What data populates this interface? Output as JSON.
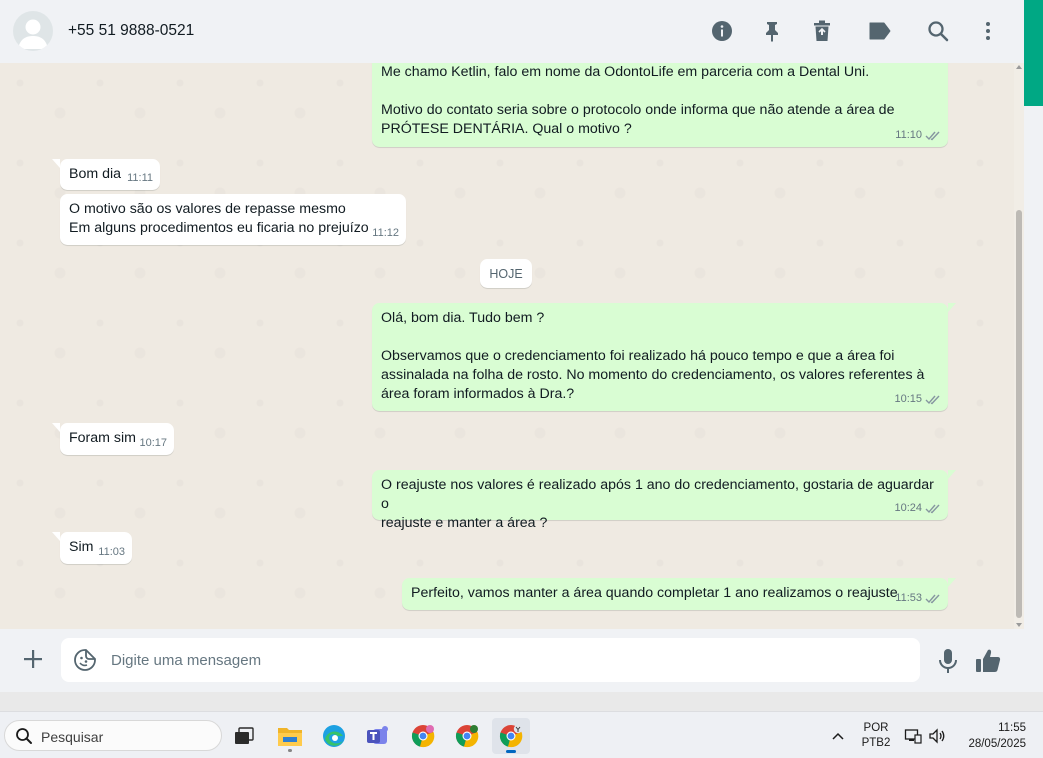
{
  "header": {
    "contact": "+55 51 9888-0521",
    "icons": [
      "info-icon",
      "pin-icon",
      "delete-icon",
      "label-icon",
      "search-icon",
      "menu-icon"
    ]
  },
  "messages": [
    {
      "dir": "out",
      "text": "Me chamo Ketlin, falo em nome da OdontoLife em parceria com a Dental Uni.\n\nMotivo do contato seria sobre o protocolo onde informa que não atende a área de\nPRÓTESE DENTÁRIA. Qual o motivo ?",
      "time": "11:10"
    },
    {
      "dir": "in",
      "text": "Bom dia",
      "time": "11:11"
    },
    {
      "dir": "in",
      "text": "O motivo são os valores de repasse mesmo\nEm alguns procedimentos eu ficaria no prejuízo",
      "time": "11:12"
    },
    {
      "dir": "out",
      "text": "Olá, bom dia. Tudo bem ?\n\nObservamos que o credenciamento foi realizado há pouco tempo e que a área foi\nassinalada na folha de rosto. No momento do credenciamento, os valores referentes à\nárea foram informados à Dra.?",
      "time": "10:15"
    },
    {
      "dir": "in",
      "text": "Foram sim",
      "time": "10:17"
    },
    {
      "dir": "out",
      "text": "O reajuste nos valores é realizado após 1 ano do credenciamento, gostaria de aguardar o\nreajuste e manter a área ?",
      "time": "10:24"
    },
    {
      "dir": "in",
      "text": "Sim",
      "time": "11:03"
    },
    {
      "dir": "out",
      "text": "Perfeito, vamos manter a área quando completar 1 ano realizamos o reajuste",
      "time": "11:53"
    }
  ],
  "date_chip": "HOJE",
  "composer": {
    "placeholder": "Digite uma mensagem"
  },
  "taskbar": {
    "search_label": "Pesquisar",
    "lang_line1": "POR",
    "lang_line2": "PTB2",
    "time": "11:55",
    "date": "28/05/2025"
  },
  "colors": {
    "outgoing_bubble": "#d9fdd3",
    "incoming_bubble": "#ffffff",
    "chat_background": "#efeae2",
    "accent": "#00a884"
  }
}
